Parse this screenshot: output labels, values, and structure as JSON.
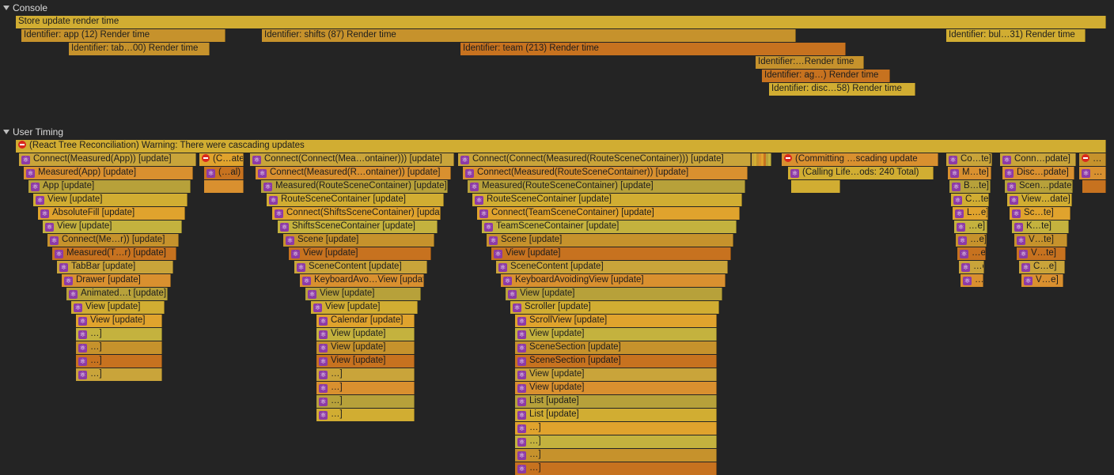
{
  "tracks": {
    "console": "Console",
    "user_timing": "User Timing"
  },
  "console_bars": [
    "Store update render time",
    "Identifier: app (12) Render time",
    "Identifier: shifts (87) Render time",
    "Identifier: bul…31) Render time",
    "Identifier: tab…00) Render time",
    "Identifier: team (213) Render time",
    "Identifier:…Render time",
    "Identifier: ag…) Render time",
    "Identifier: disc…58) Render time"
  ],
  "timing": {
    "warning": "(React Tree Reconciliation) Warning: There were cascading updates",
    "col_app": [
      "Connect(Measured(App)) [update]",
      "Measured(App) [update]",
      "App [update]",
      "View [update]",
      "AbsoluteFill [update]",
      "View [update]",
      "Connect(Me…r)) [update]",
      "Measured(T…r) [update]",
      "TabBar [update]",
      "Drawer [update]",
      "Animated…t [update]",
      "View [update]",
      "View [update]",
      "…]",
      "…]",
      "…]",
      "…]"
    ],
    "col_small": [
      "(C…ate",
      "(…al)"
    ],
    "col_shifts": [
      "Connect(Connect(Mea…ontainer))) [update]",
      "Connect(Measured(R…ontainer)) [update]",
      "Measured(RouteSceneContainer) [update]",
      "RouteSceneContainer [update]",
      "Connect(ShiftsSceneContainer) [update]",
      "ShiftsSceneContainer [update]",
      "Scene [update]",
      "View [update]",
      "SceneContent [update]",
      "KeyboardAvo…View [update]",
      "View [update]",
      "View [update]",
      "Calendar [update]",
      "View [update]",
      "View [update]",
      "View [update]",
      "…]",
      "…]",
      "…]",
      "…]"
    ],
    "col_team": [
      "Connect(Connect(Measured(RouteSceneContainer))) [update]",
      "Connect(Measured(RouteSceneContainer)) [update]",
      "Measured(RouteSceneContainer) [update]",
      "RouteSceneContainer [update]",
      "Connect(TeamSceneContainer) [update]",
      "TeamSceneContainer [update]",
      "Scene [update]",
      "View [update]",
      "SceneContent [update]",
      "KeyboardAvoidingView [update]",
      "View [update]",
      "Scroller [update]",
      "ScrollView [update]",
      "View [update]",
      "SceneSection [update]",
      "SceneSection [update]",
      "View [update]",
      "View [update]",
      "List [update]",
      "List [update]",
      "…]",
      "…]",
      "…]",
      "…]"
    ],
    "committing": "(Committing …scading update",
    "calling": "(Calling Life…ods: 240 Total)",
    "col_r1": [
      "Co…te]",
      "M…te]",
      "B…te]",
      "C…te]",
      "L…e]",
      "…e]",
      "…e]",
      "…e]",
      "…e]",
      "…e]"
    ],
    "col_r2": [
      "Conn…pdate]",
      "Disc…pdate]",
      "Scen…pdate]",
      "View…date]",
      "Sc…te]",
      "K…te]",
      "V…te]",
      "V…te]",
      "C…e]",
      "V…e]"
    ],
    "col_r3": [
      "…",
      "…"
    ]
  }
}
